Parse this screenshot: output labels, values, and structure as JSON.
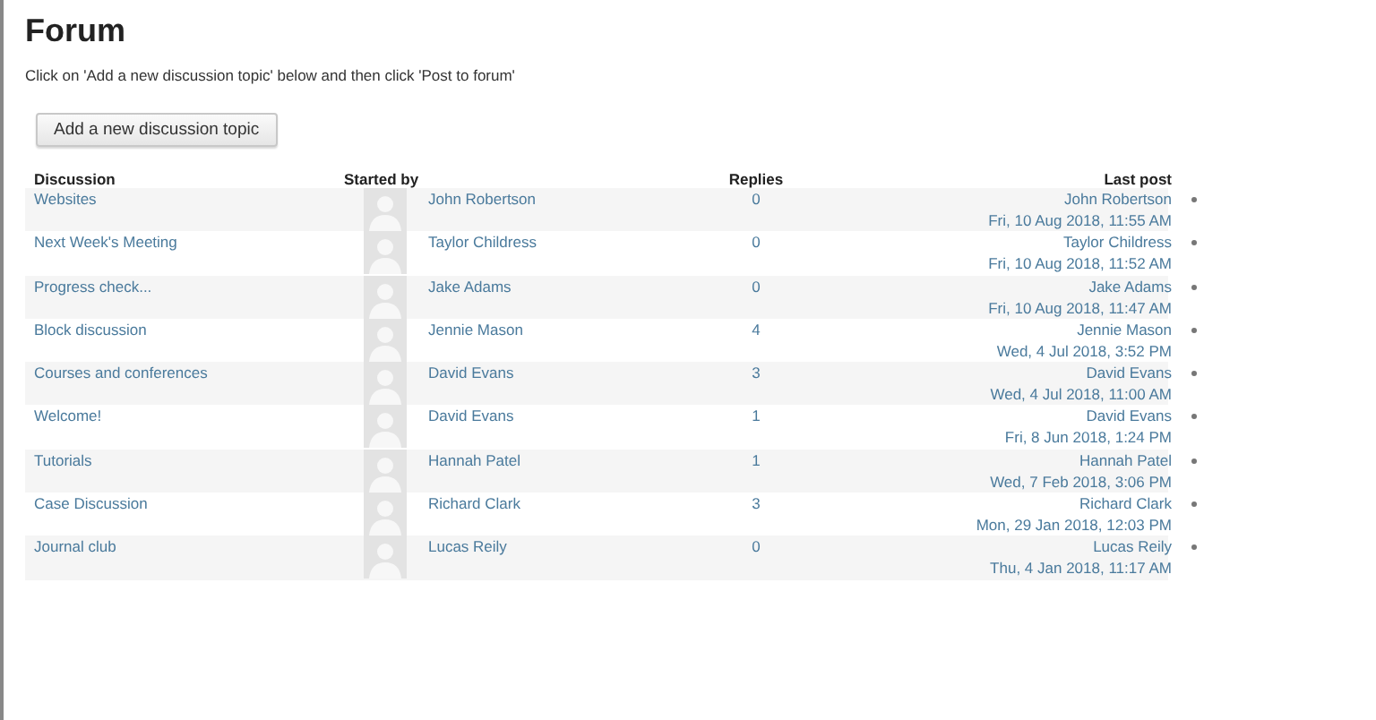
{
  "title": "Forum",
  "instructions": "Click on 'Add a new discussion topic' below and then click 'Post to forum'",
  "add_button": "Add a new discussion topic",
  "table": {
    "columns": [
      "Discussion",
      "Started by",
      "Replies",
      "Last post"
    ],
    "rows": [
      {
        "discussion": "Websites",
        "started_by": "John Robertson",
        "replies": "0",
        "last_post_author": "John Robertson",
        "last_post_date": "Fri, 10 Aug 2018, 11:55 AM"
      },
      {
        "discussion": "Next Week's Meeting",
        "started_by": "Taylor Childress",
        "replies": "0",
        "last_post_author": "Taylor Childress",
        "last_post_date": "Fri, 10 Aug 2018, 11:52 AM"
      },
      {
        "discussion": "Progress check...",
        "started_by": "Jake Adams",
        "replies": "0",
        "last_post_author": "Jake Adams",
        "last_post_date": "Fri, 10 Aug 2018, 11:47 AM"
      },
      {
        "discussion": "Block discussion",
        "started_by": "Jennie Mason",
        "replies": "4",
        "last_post_author": "Jennie Mason",
        "last_post_date": "Wed, 4 Jul 2018, 3:52 PM"
      },
      {
        "discussion": "Courses and conferences",
        "started_by": "David Evans",
        "replies": "3",
        "last_post_author": "David Evans",
        "last_post_date": "Wed, 4 Jul 2018, 11:00 AM"
      },
      {
        "discussion": "Welcome!",
        "started_by": "David Evans",
        "replies": "1",
        "last_post_author": "David Evans",
        "last_post_date": "Fri, 8 Jun 2018, 1:24 PM"
      },
      {
        "discussion": "Tutorials",
        "started_by": "Hannah Patel",
        "replies": "1",
        "last_post_author": "Hannah Patel",
        "last_post_date": "Wed, 7 Feb 2018, 3:06 PM"
      },
      {
        "discussion": "Case Discussion",
        "started_by": "Richard Clark",
        "replies": "3",
        "last_post_author": "Richard Clark",
        "last_post_date": "Mon, 29 Jan 2018, 12:03 PM"
      },
      {
        "discussion": "Journal club",
        "started_by": "Lucas Reily",
        "replies": "0",
        "last_post_author": "Lucas Reily",
        "last_post_date": "Thu, 4 Jan 2018, 11:17 AM"
      }
    ]
  }
}
